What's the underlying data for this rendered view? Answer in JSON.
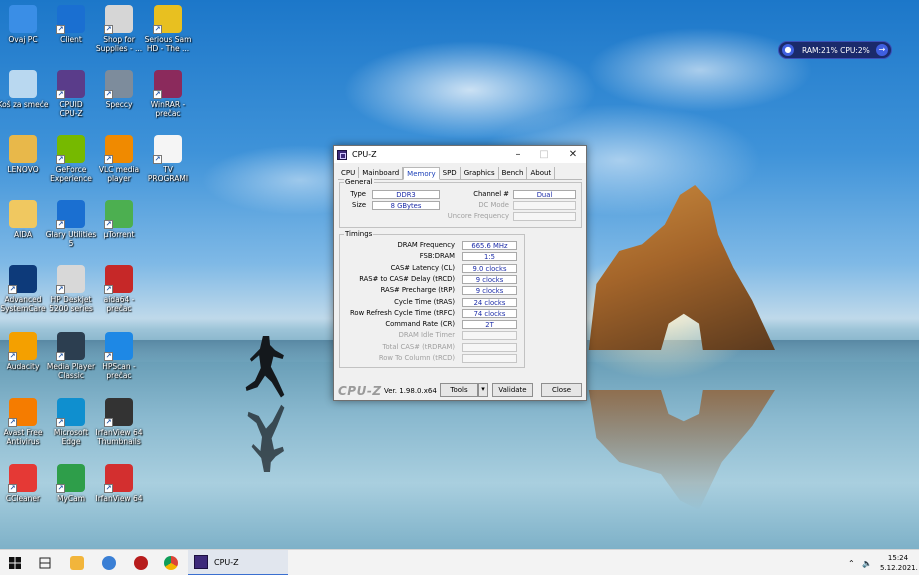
{
  "desktop_icons": [
    {
      "label": "Ovaj PC",
      "icon": "computer-icon",
      "color": "#3a8ee6"
    },
    {
      "label": "Client",
      "icon": "client-app-icon",
      "color": "#1a6fd1"
    },
    {
      "label": "Shop for\nSupplies - ...",
      "icon": "printer-icon",
      "color": "#d6d6d6"
    },
    {
      "label": "Serious Sam\nHD - The ...",
      "icon": "serious-sam-icon",
      "color": "#e8c020"
    },
    {
      "label": "Koš za smeće",
      "icon": "recycle-bin-icon",
      "color": "#b9d8f0"
    },
    {
      "label": "CPUID\nCPU-Z",
      "icon": "cpu-z-icon",
      "color": "#5a3c8a"
    },
    {
      "label": "Speccy",
      "icon": "speccy-icon",
      "color": "#7d8c9c"
    },
    {
      "label": "WinRAR -\nprečac",
      "icon": "winrar-icon",
      "color": "#8b2a5c"
    },
    {
      "label": "LENOVO",
      "icon": "folder-user-icon",
      "color": "#e8b84a"
    },
    {
      "label": "GeForce\nExperience",
      "icon": "nvidia-icon",
      "color": "#76b900"
    },
    {
      "label": "VLC media\nplayer",
      "icon": "vlc-icon",
      "color": "#f08a00"
    },
    {
      "label": "TV\nPROGRAMI",
      "icon": "text-file-icon",
      "color": "#f5f5f5"
    },
    {
      "label": "AIDA",
      "icon": "folder-icon",
      "color": "#f0c860"
    },
    {
      "label": "Glary Utilities\n5",
      "icon": "glary-utilities-icon",
      "color": "#1a6fd1"
    },
    {
      "label": "µTorrent",
      "icon": "utorrent-icon",
      "color": "#4caf50"
    },
    {
      "label": "Advanced\nSystemCare",
      "icon": "advanced-systemcare-icon",
      "color": "#0d3a7a"
    },
    {
      "label": "HP Deskjet\n5200 series",
      "icon": "hp-printer-icon",
      "color": "#d8d8d8"
    },
    {
      "label": "aida64 -\nprečac",
      "icon": "aida64-icon",
      "color": "#c62828"
    },
    {
      "label": "Audacity",
      "icon": "audacity-icon",
      "color": "#f4a000"
    },
    {
      "label": "Media Player\nClassic",
      "icon": "media-player-classic-icon",
      "color": "#2c3e50"
    },
    {
      "label": "HPScan -\nprečac",
      "icon": "hp-scan-icon",
      "color": "#1e88e5"
    },
    {
      "label": "Avast Free\nAntivirus",
      "icon": "avast-icon",
      "color": "#f57c00"
    },
    {
      "label": "Microsoft\nEdge",
      "icon": "edge-icon",
      "color": "#0f8fcf"
    },
    {
      "label": "IrfanView 64\nThumbnails",
      "icon": "irfanview-thumbnails-icon",
      "color": "#333333"
    },
    {
      "label": "CCleaner",
      "icon": "ccleaner-icon",
      "color": "#e53935"
    },
    {
      "label": "MyCam",
      "icon": "mycam-icon",
      "color": "#2e9e4a"
    },
    {
      "label": "IrfanView 64",
      "icon": "irfanview-icon",
      "color": "#d32f2f"
    }
  ],
  "sysmon": {
    "text": "RAM:21%  CPU:2%",
    "accent": "#3f5fe0"
  },
  "cpuz": {
    "title": "CPU-Z",
    "tabs": [
      "CPU",
      "Mainboard",
      "Memory",
      "SPD",
      "Graphics",
      "Bench",
      "About"
    ],
    "active_tab": "Memory",
    "general": {
      "title": "General",
      "type_label": "Type",
      "type_value": "DDR3",
      "size_label": "Size",
      "size_value": "8 GBytes",
      "channel_label": "Channel #",
      "channel_value": "Dual",
      "dcmode_label": "DC Mode",
      "dcmode_value": "",
      "uncore_label": "Uncore Frequency",
      "uncore_value": ""
    },
    "timings": {
      "title": "Timings",
      "rows": [
        {
          "label": "DRAM Frequency",
          "value": "665.6 MHz",
          "enabled": true
        },
        {
          "label": "FSB:DRAM",
          "value": "1:5",
          "enabled": true
        },
        {
          "label": "CAS# Latency (CL)",
          "value": "9.0 clocks",
          "enabled": true
        },
        {
          "label": "RAS# to CAS# Delay (tRCD)",
          "value": "9 clocks",
          "enabled": true
        },
        {
          "label": "RAS# Precharge (tRP)",
          "value": "9 clocks",
          "enabled": true
        },
        {
          "label": "Cycle Time (tRAS)",
          "value": "24 clocks",
          "enabled": true
        },
        {
          "label": "Row Refresh Cycle Time (tRFC)",
          "value": "74 clocks",
          "enabled": true
        },
        {
          "label": "Command Rate (CR)",
          "value": "2T",
          "enabled": true
        },
        {
          "label": "DRAM Idle Timer",
          "value": "",
          "enabled": false
        },
        {
          "label": "Total CAS# (tRDRAM)",
          "value": "",
          "enabled": false
        },
        {
          "label": "Row To Column (tRCD)",
          "value": "",
          "enabled": false
        }
      ]
    },
    "logo": "CPU-Z",
    "version": "Ver. 1.98.0.x64",
    "tools_label": "Tools",
    "validate_label": "Validate",
    "close_label": "Close",
    "value_color": "#1c2ca8"
  },
  "taskbar": {
    "cpuz_label": "CPU-Z",
    "time": "15:24",
    "date": "5.12.2021."
  }
}
